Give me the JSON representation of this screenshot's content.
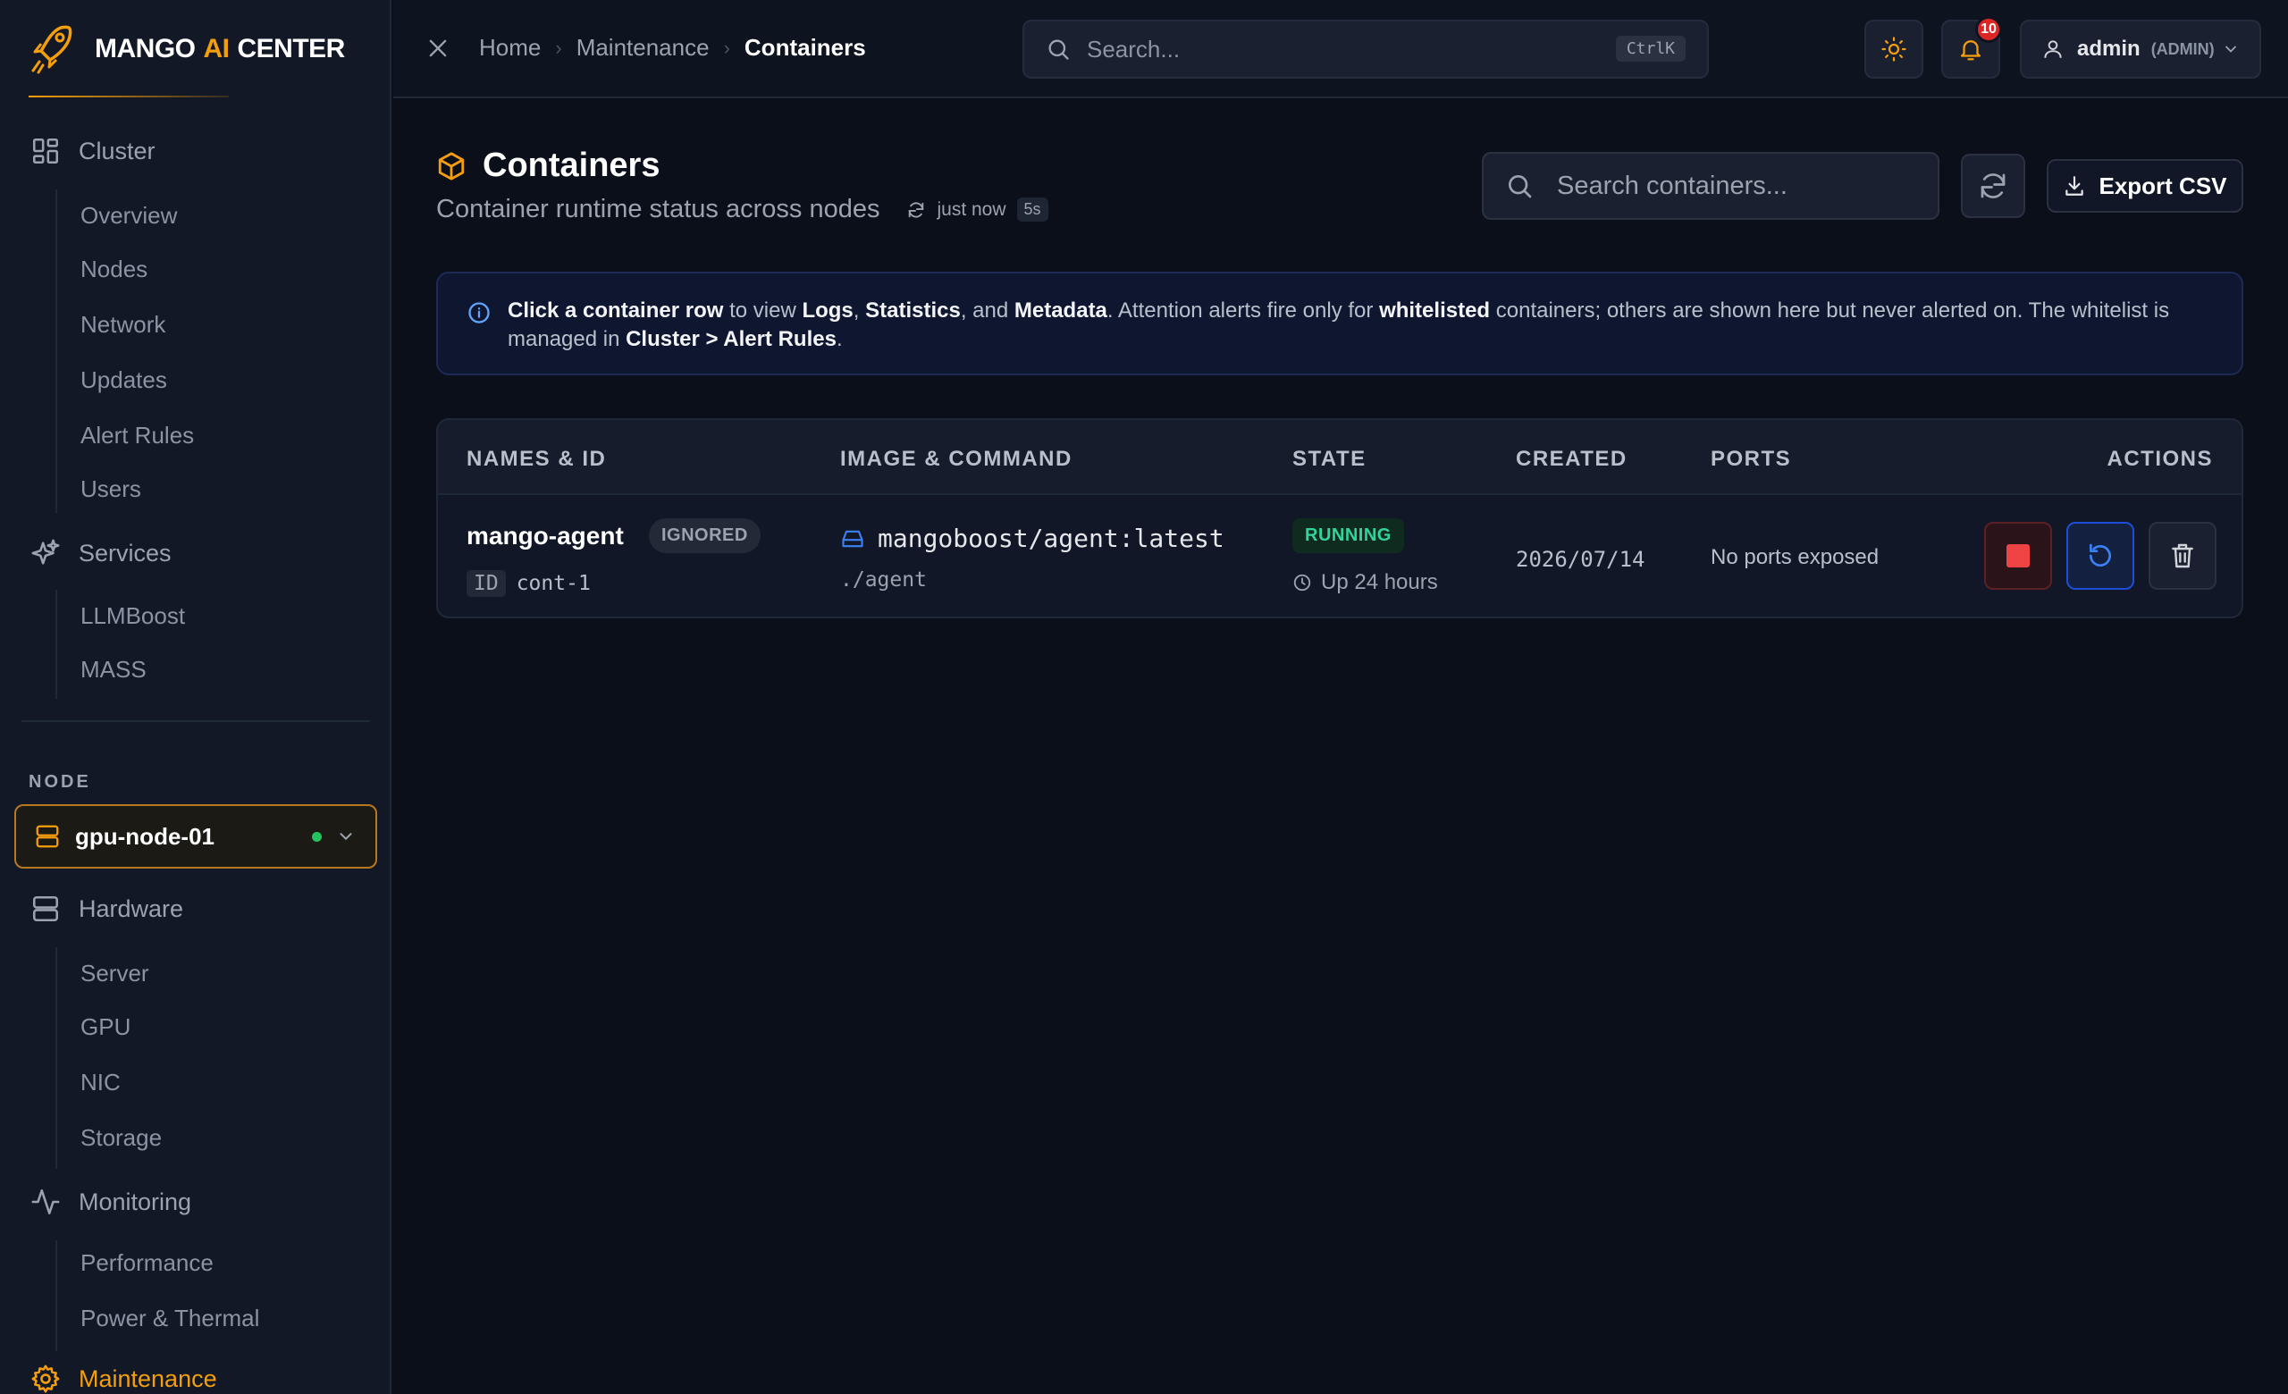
{
  "brand": {
    "part1": "MANGO",
    "part2": "AI",
    "part3": "CENTER"
  },
  "sidebar": {
    "cluster": {
      "label": "Cluster",
      "items": [
        "Overview",
        "Nodes",
        "Network",
        "Updates",
        "Alert Rules",
        "Users"
      ]
    },
    "services": {
      "label": "Services",
      "items": [
        "LLMBoost",
        "MASS"
      ]
    },
    "node_section_label": "NODE",
    "node_selector": {
      "value": "gpu-node-01",
      "status_color": "#22c55e"
    },
    "hardware": {
      "label": "Hardware",
      "items": [
        "Server",
        "GPU",
        "NIC",
        "Storage"
      ]
    },
    "monitoring": {
      "label": "Monitoring",
      "items": [
        "Performance",
        "Power & Thermal"
      ]
    },
    "maintenance": {
      "label": "Maintenance"
    }
  },
  "topbar": {
    "breadcrumbs": [
      "Home",
      "Maintenance",
      "Containers"
    ],
    "search_placeholder": "Search...",
    "search_shortcut": "CtrlK",
    "notifications_count": "10",
    "user_name": "admin",
    "user_role": "(ADMIN)"
  },
  "page": {
    "title": "Containers",
    "subtitle": "Container runtime status across nodes",
    "last_refresh": "just now",
    "refresh_interval": "5s",
    "search_placeholder": "Search containers...",
    "export_label": "Export CSV"
  },
  "info": {
    "t1": "Click a container row",
    "t2": " to view ",
    "t3": "Logs",
    "t4": ", ",
    "t5": "Statistics",
    "t6": ", and ",
    "t7": "Metadata",
    "t8": ". Attention alerts fire only for ",
    "t9": "whitelisted",
    "t10": " containers; others are shown here but never alerted on. The whitelist is managed in ",
    "t11": "Cluster > Alert Rules",
    "t12": "."
  },
  "table": {
    "columns": [
      "NAMES & ID",
      "IMAGE & COMMAND",
      "STATE",
      "CREATED",
      "PORTS",
      "ACTIONS"
    ],
    "rows": [
      {
        "name": "mango-agent",
        "tag": "IGNORED",
        "id_label": "ID",
        "id": "cont-1",
        "image": "mangoboost/agent:latest",
        "command": "./agent",
        "state": "RUNNING",
        "uptime": "Up 24 hours",
        "created": "2026/07/14",
        "ports": "No ports exposed"
      }
    ]
  },
  "colors": {
    "accent": "#f59e0b",
    "running": "#34d399",
    "stop": "#ef4444",
    "restart": "#3b82f6"
  }
}
